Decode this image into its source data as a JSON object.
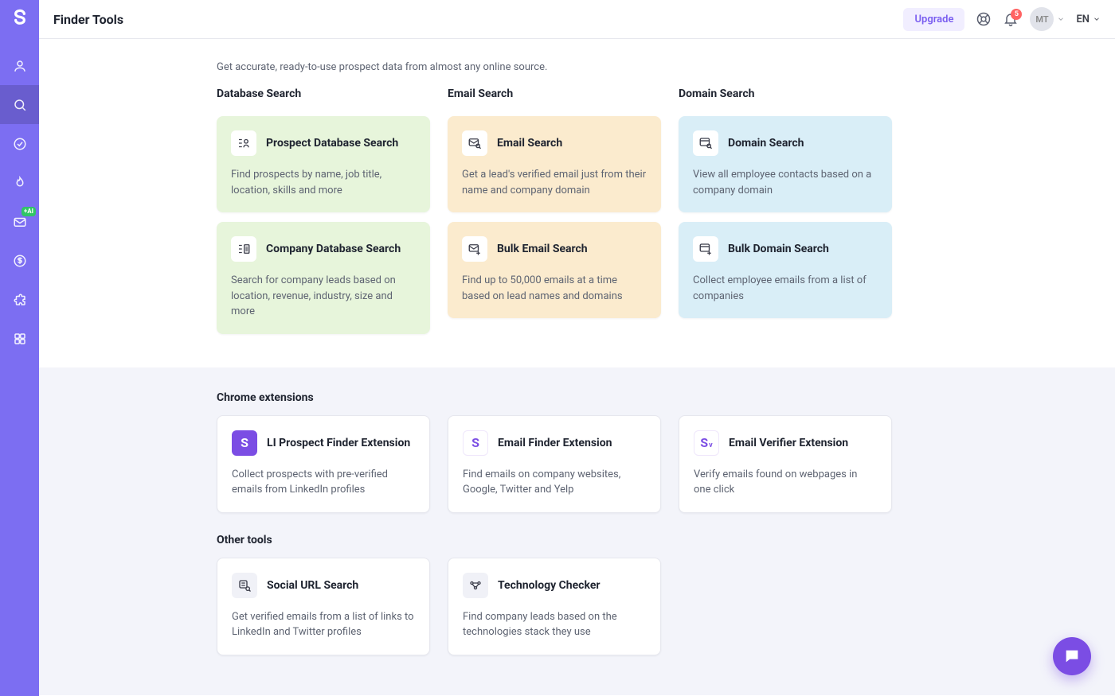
{
  "header": {
    "title": "Finder Tools",
    "upgrade": "Upgrade",
    "notif_count": "5",
    "avatar_initials": "MT",
    "lang": "EN"
  },
  "sidebar": {
    "items": [
      {
        "name": "contacts"
      },
      {
        "name": "search"
      },
      {
        "name": "verify"
      },
      {
        "name": "warmup"
      },
      {
        "name": "campaigns",
        "badge": "+AI"
      },
      {
        "name": "deals"
      },
      {
        "name": "extensions"
      },
      {
        "name": "apps"
      }
    ]
  },
  "intro": "Get accurate, ready-to-use prospect data from almost any online source.",
  "columns": [
    {
      "heading": "Database Search",
      "color": "green",
      "cards": [
        {
          "icon": "person-list",
          "title": "Prospect Database Search",
          "desc": "Find prospects by name, job title, location, skills and more"
        },
        {
          "icon": "company-list",
          "title": "Company Database Search",
          "desc": "Search for company leads based on location, revenue, industry, size and more"
        }
      ]
    },
    {
      "heading": "Email Search",
      "color": "orange",
      "cards": [
        {
          "icon": "mail-search",
          "title": "Email Search",
          "desc": "Get a lead's verified email just from their name and company domain"
        },
        {
          "icon": "mail-bulk",
          "title": "Bulk Email Search",
          "desc": "Find up to 50,000 emails at a time based on lead names and domains"
        }
      ]
    },
    {
      "heading": "Domain Search",
      "color": "blue",
      "cards": [
        {
          "icon": "globe-search",
          "title": "Domain Search",
          "desc": "View all employee contacts based on a company domain"
        },
        {
          "icon": "globe-bulk",
          "title": "Bulk Domain Search",
          "desc": "Collect employee emails from a list of companies"
        }
      ]
    }
  ],
  "chrome_heading": "Chrome extensions",
  "chrome_cards": [
    {
      "icon": "s-purple",
      "title": "LI Prospect Finder Extension",
      "desc": "Collect prospects with pre-verified emails from LinkedIn profiles"
    },
    {
      "icon": "s-outline",
      "title": "Email Finder Extension",
      "desc": "Find emails on company websites, Google, Twitter and Yelp"
    },
    {
      "icon": "sv-outline",
      "title": "Email Verifier Extension",
      "desc": "Verify emails found on webpages in one click"
    }
  ],
  "other_heading": "Other tools",
  "other_cards": [
    {
      "icon": "social-search",
      "title": "Social URL Search",
      "desc": "Get verified emails from a list of links to LinkedIn and Twitter profiles"
    },
    {
      "icon": "tech-check",
      "title": "Technology Checker",
      "desc": "Find company leads based on the technologies stack they use"
    }
  ]
}
